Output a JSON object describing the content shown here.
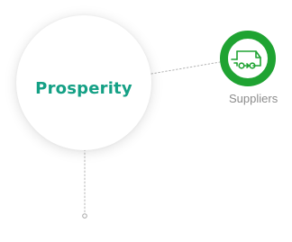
{
  "hub": {
    "title": "Prosperity"
  },
  "node": {
    "label": "Suppliers",
    "icon": "delivery-truck-icon"
  },
  "colors": {
    "hub_text": "#14a085",
    "node_ring": "#1fa332",
    "icon_stroke": "#1fa332",
    "label_text": "#8c8c8c",
    "connector": "#b3b3b3"
  }
}
